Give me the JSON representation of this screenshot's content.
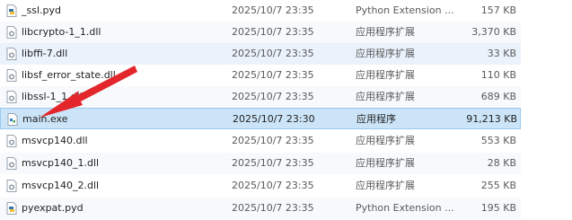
{
  "colors": {
    "selected_bg": "#cce4f7",
    "selected_border": "#99c9ef",
    "arrow": "#e3262b"
  },
  "files": [
    {
      "name": "_ssl.pyd",
      "date": "2025/10/7 23:35",
      "type": "Python Extension ...",
      "size": "157 KB",
      "icon": "python-file-icon"
    },
    {
      "name": "libcrypto-1_1.dll",
      "date": "2025/10/7 23:35",
      "type": "应用程序扩展",
      "size": "3,370 KB",
      "icon": "dll-file-icon"
    },
    {
      "name": "libffi-7.dll",
      "date": "2025/10/7 23:35",
      "type": "应用程序扩展",
      "size": "33 KB",
      "icon": "dll-file-icon"
    },
    {
      "name": "libsf_error_state.dll",
      "date": "2025/10/7 23:35",
      "type": "应用程序扩展",
      "size": "110 KB",
      "icon": "dll-file-icon"
    },
    {
      "name": "libssl-1_1.dll",
      "date": "2025/10/7 23:35",
      "type": "应用程序扩展",
      "size": "689 KB",
      "icon": "dll-file-icon"
    },
    {
      "name": "main.exe",
      "date": "2025/10/7 23:30",
      "type": "应用程序",
      "size": "91,213 KB",
      "icon": "exe-file-icon"
    },
    {
      "name": "msvcp140.dll",
      "date": "2025/10/7 23:35",
      "type": "应用程序扩展",
      "size": "553 KB",
      "icon": "dll-file-icon"
    },
    {
      "name": "msvcp140_1.dll",
      "date": "2025/10/7 23:35",
      "type": "应用程序扩展",
      "size": "28 KB",
      "icon": "dll-file-icon"
    },
    {
      "name": "msvcp140_2.dll",
      "date": "2025/10/7 23:35",
      "type": "应用程序扩展",
      "size": "255 KB",
      "icon": "dll-file-icon"
    },
    {
      "name": "pyexpat.pyd",
      "date": "2025/10/7 23:35",
      "type": "Python Extension ...",
      "size": "195 KB",
      "icon": "python-file-icon"
    }
  ]
}
